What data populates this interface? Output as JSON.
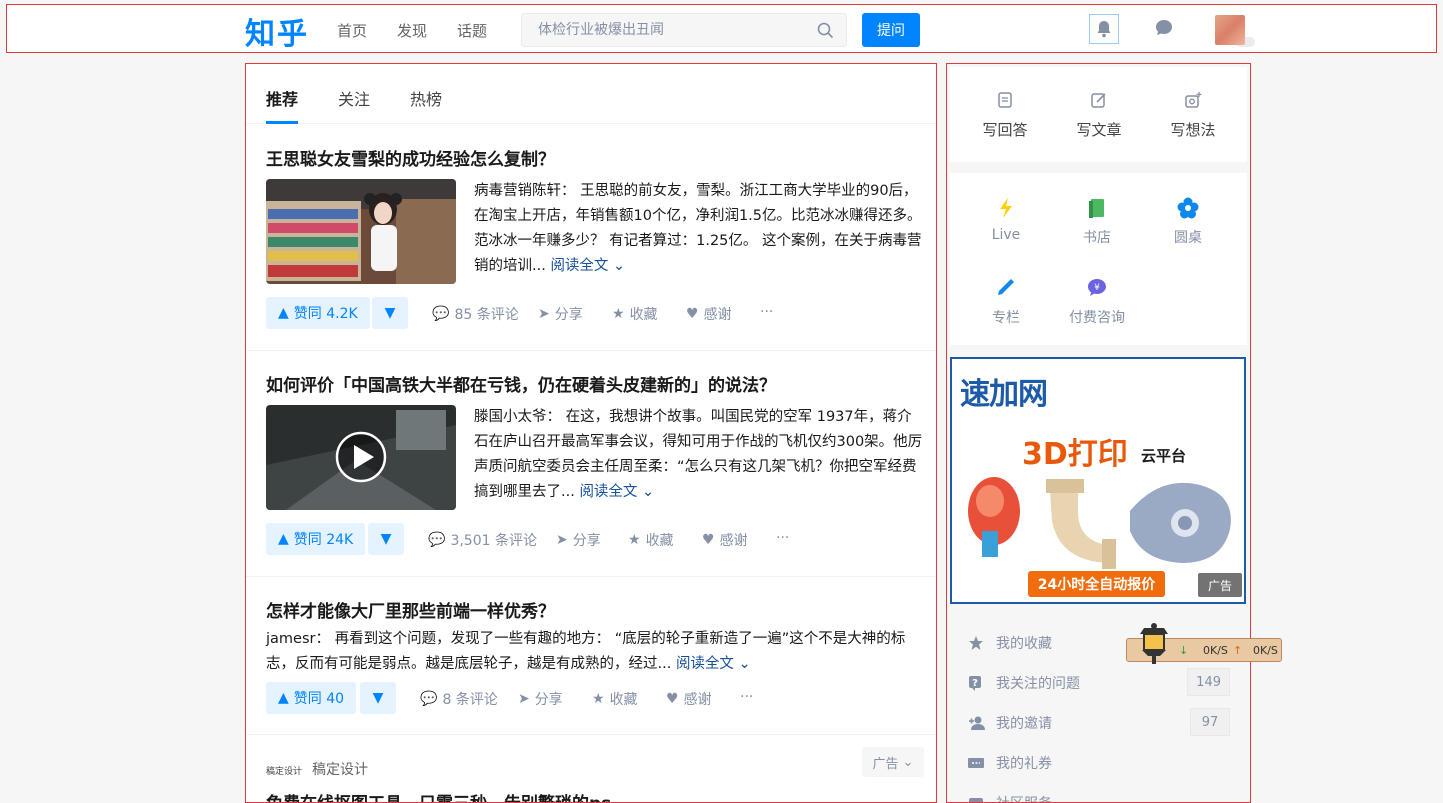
{
  "header": {
    "logo": "知乎",
    "nav": [
      "首页",
      "发现",
      "话题"
    ],
    "search_placeholder": "体检行业被爆出丑闻",
    "ask_label": "提问"
  },
  "feed": {
    "tabs": [
      "推荐",
      "关注",
      "热榜"
    ],
    "cards": [
      {
        "title": "王思聪女友雪梨的成功经验怎么复制？",
        "excerpt": "病毒营销陈轩： 王思聪的前女友，雪梨。浙江工商大学毕业的90后，在淘宝上开店，年销售额10个亿，净利润1.5亿。比范冰冰赚得还多。 范冰冰一年赚多少？ 有记者算过：1.25亿。 这个案例，在关于病毒营销的培训...",
        "read_more": "阅读全文",
        "vote": "赞同 4.2K",
        "comments": "85 条评论",
        "share": "分享",
        "collect": "收藏",
        "thanks": "感谢",
        "more": "···"
      },
      {
        "title": "如何评价「中国高铁大半都在亏钱，仍在硬着头皮建新的」的说法？",
        "excerpt": "滕国小太爷： 在这，我想讲个故事。叫国民党的空军 1937年，蒋介石在庐山召开最高军事会议，得知可用于作战的飞机仅约300架。他厉声质问航空委员会主任周至柔：“怎么只有这几架飞机？你把空军经费搞到哪里去了...",
        "read_more": "阅读全文",
        "vote": "赞同 24K",
        "comments": "3,501 条评论",
        "share": "分享",
        "collect": "收藏",
        "thanks": "感谢",
        "more": "···"
      },
      {
        "title": "怎样才能像大厂里那些前端一样优秀？",
        "excerpt": "jamesr： 再看到这个问题，发现了一些有趣的地方： “底层的轮子重新造了一遍”这个不是大神的标志，反而有可能是弱点。越是底层轮子，越是有成熟的，经过...",
        "read_more": "阅读全文",
        "vote": "赞同 40",
        "comments": "8 条评论",
        "share": "分享",
        "collect": "收藏",
        "thanks": "感谢",
        "more": "···"
      }
    ],
    "ad_card": {
      "source": "稿定设计",
      "tag": "广告",
      "title": "免费在线抠图工具，只需三秒，告别繁琐的ps"
    }
  },
  "sidebar": {
    "write": [
      "写回答",
      "写文章",
      "写想法"
    ],
    "quick": [
      "Live",
      "书店",
      "圆桌",
      "专栏",
      "付费咨询"
    ],
    "ad": {
      "logo": "速加网",
      "title": "3D打印",
      "subtitle": "云平台",
      "cta": "24小时全自动报价",
      "badge": "广告"
    },
    "menu": [
      {
        "label": "我的收藏",
        "count": ""
      },
      {
        "label": "我关注的问题",
        "count": "149"
      },
      {
        "label": "我的邀请",
        "count": "97"
      },
      {
        "label": "我的礼券",
        "count": ""
      },
      {
        "label": "社区服务",
        "count": ""
      }
    ]
  },
  "overlay": {
    "down_speed": "0K/S",
    "up_speed": "0K/S"
  },
  "colors": {
    "brand": "#0084ff",
    "link": "#175199",
    "muted": "#8590a6",
    "annotation_border": "#e0393e"
  }
}
